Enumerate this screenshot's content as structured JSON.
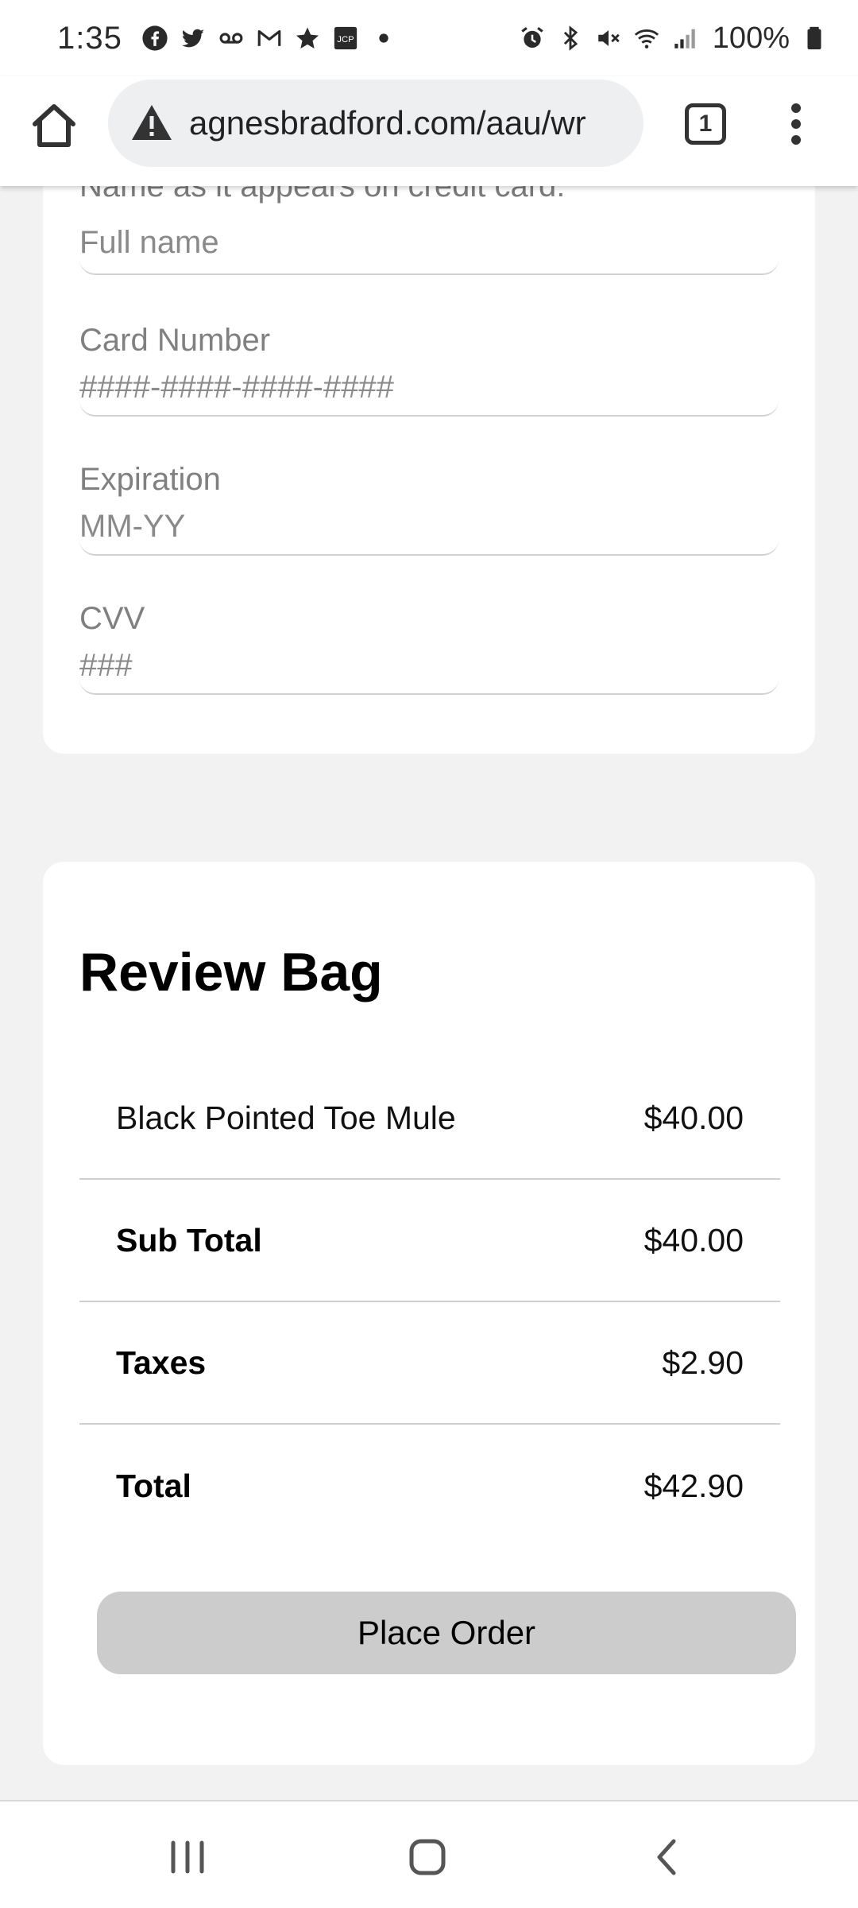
{
  "status_bar": {
    "time": "1:35",
    "battery": "100%",
    "left_icons": [
      "facebook-icon",
      "twitter-icon",
      "voicemail-icon",
      "gmail-icon",
      "star-icon",
      "jcp-icon",
      "dot-icon"
    ],
    "right_icons": [
      "alarm-icon",
      "bluetooth-icon",
      "mute-icon",
      "wifi-icon",
      "signal-icon",
      "battery-icon"
    ]
  },
  "browser": {
    "url": "agnesbradford.com/aau/wr",
    "tab_count": "1"
  },
  "payment": {
    "name_label_cut": "Name as it appears on credit card:",
    "name_placeholder": "Full name",
    "card_label": "Card Number",
    "card_placeholder": "####-####-####-####",
    "expiration_label": "Expiration",
    "expiration_placeholder": "MM-YY",
    "cvv_label": "CVV",
    "cvv_placeholder": "###"
  },
  "review": {
    "title": "Review Bag",
    "item_name": "Black Pointed Toe Mule",
    "item_price": "$40.00",
    "subtotal_label": "Sub Total",
    "subtotal_value": "$40.00",
    "taxes_label": "Taxes",
    "taxes_value": "$2.90",
    "total_label": "Total",
    "total_value": "$42.90",
    "place_order": "Place Order"
  },
  "colors": {
    "button_bg": "#cccccc",
    "page_bg": "#f2f2f2",
    "card_bg": "#ffffff"
  }
}
